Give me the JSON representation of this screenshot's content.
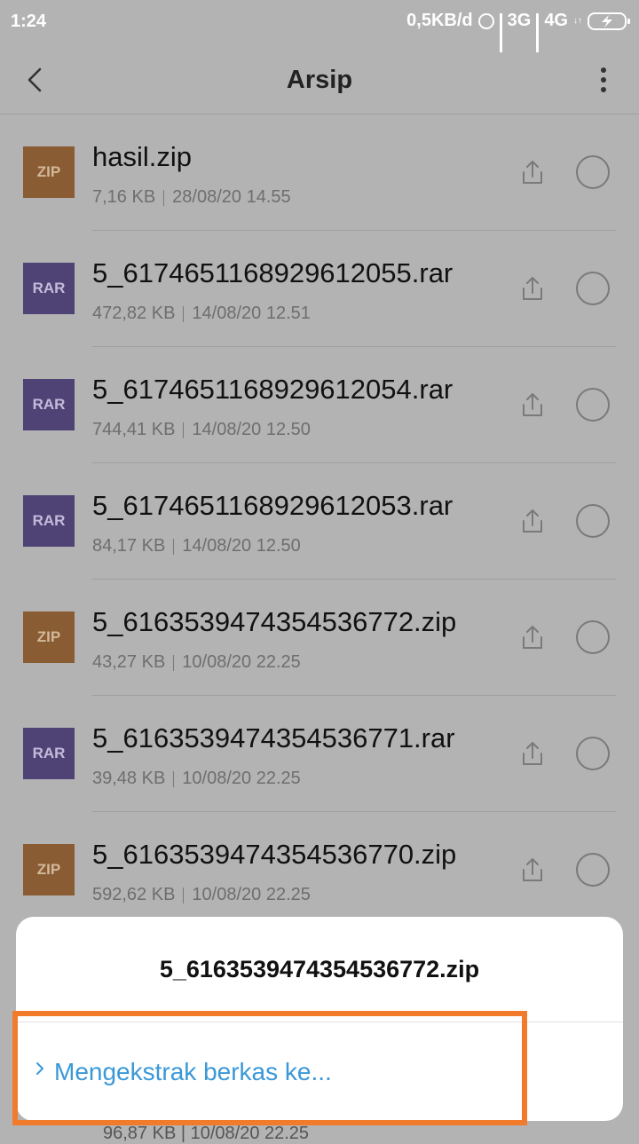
{
  "status": {
    "time": "1:24",
    "speed": "0,5KB/d",
    "net1": "3G",
    "net2": "4G",
    "net2_sub": "↓↑"
  },
  "header": {
    "title": "Arsip"
  },
  "files": [
    {
      "type": "ZIP",
      "name": "hasil.zip",
      "size": "7,16 KB",
      "date": "28/08/20 14.55"
    },
    {
      "type": "RAR",
      "name": "5_6174651168929612055.rar",
      "size": "472,82 KB",
      "date": "14/08/20 12.51"
    },
    {
      "type": "RAR",
      "name": "5_6174651168929612054.rar",
      "size": "744,41 KB",
      "date": "14/08/20 12.50"
    },
    {
      "type": "RAR",
      "name": "5_6174651168929612053.rar",
      "size": "84,17 KB",
      "date": "14/08/20 12.50"
    },
    {
      "type": "ZIP",
      "name": "5_6163539474354536772.zip",
      "size": "43,27 KB",
      "date": "10/08/20 22.25"
    },
    {
      "type": "RAR",
      "name": "5_6163539474354536771.rar",
      "size": "39,48 KB",
      "date": "10/08/20 22.25"
    },
    {
      "type": "ZIP",
      "name": "5_6163539474354536770.zip",
      "size": "592,62 KB",
      "date": "10/08/20 22.25"
    }
  ],
  "peek_row": {
    "text": "96,87 KB  |  10/08/20 22.25"
  },
  "sheet": {
    "title": "5_6163539474354536772.zip",
    "option_label": "Mengekstrak berkas ke..."
  },
  "colors": {
    "accent": "#3a98d7",
    "highlight": "#f27a2b",
    "zip": "#8a5c34",
    "rar": "#4f4376"
  }
}
